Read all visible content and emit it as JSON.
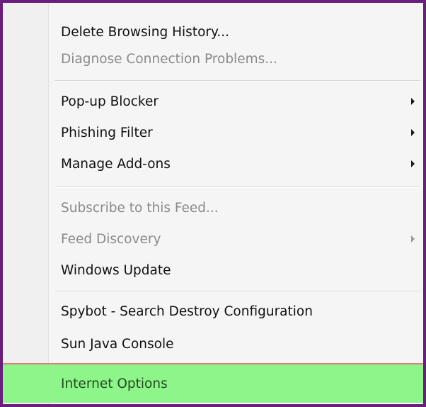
{
  "menu": {
    "items": [
      {
        "label": "Delete Browsing History...",
        "disabled": false,
        "submenu": false
      },
      {
        "label": "Diagnose Connection Problems...",
        "disabled": true,
        "submenu": false
      },
      {
        "label": "Pop-up Blocker",
        "disabled": false,
        "submenu": true
      },
      {
        "label": "Phishing Filter",
        "disabled": false,
        "submenu": true
      },
      {
        "label": "Manage Add-ons",
        "disabled": false,
        "submenu": true
      },
      {
        "label": "Subscribe to this Feed...",
        "disabled": true,
        "submenu": false
      },
      {
        "label": "Feed Discovery",
        "disabled": true,
        "submenu": true
      },
      {
        "label": "Windows Update",
        "disabled": false,
        "submenu": false
      },
      {
        "label": "Spybot - Search  Destroy Configuration",
        "disabled": false,
        "submenu": false
      },
      {
        "label": "Sun Java Console",
        "disabled": false,
        "submenu": false
      },
      {
        "label": "Internet Options",
        "disabled": false,
        "submenu": false,
        "highlighted": true
      }
    ]
  },
  "colors": {
    "frame_border": "#6a1f7d",
    "highlight_bg": "#8ef58a",
    "highlight_border": "#e47b7b",
    "disabled_text": "#8a8a8a"
  }
}
